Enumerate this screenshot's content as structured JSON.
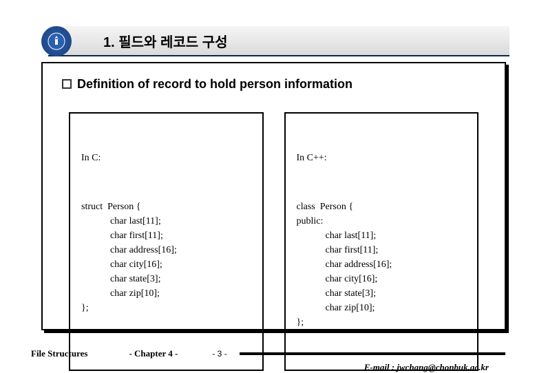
{
  "header": {
    "title": "1. 필드와 레코드 구성"
  },
  "content": {
    "bullet": "Definition of record to hold person information",
    "c_label": "In C:",
    "c_code": "struct  Person {\n            char last[11];\n            char first[11];\n            char address[16];\n            char city[16];\n            char state[3];\n            char zip[10];\n};",
    "cpp_label": "In C++:",
    "cpp_code": "class  Person {\npublic:\n            char last[11];\n            char first[11];\n            char address[16];\n            char city[16];\n            char state[3];\n            char zip[10];\n};"
  },
  "footer": {
    "left": "File Structures",
    "chapter": "- Chapter 4 -",
    "page": "- 3 -",
    "email": "E-mail : jwchang@chonbuk.ac.kr"
  }
}
